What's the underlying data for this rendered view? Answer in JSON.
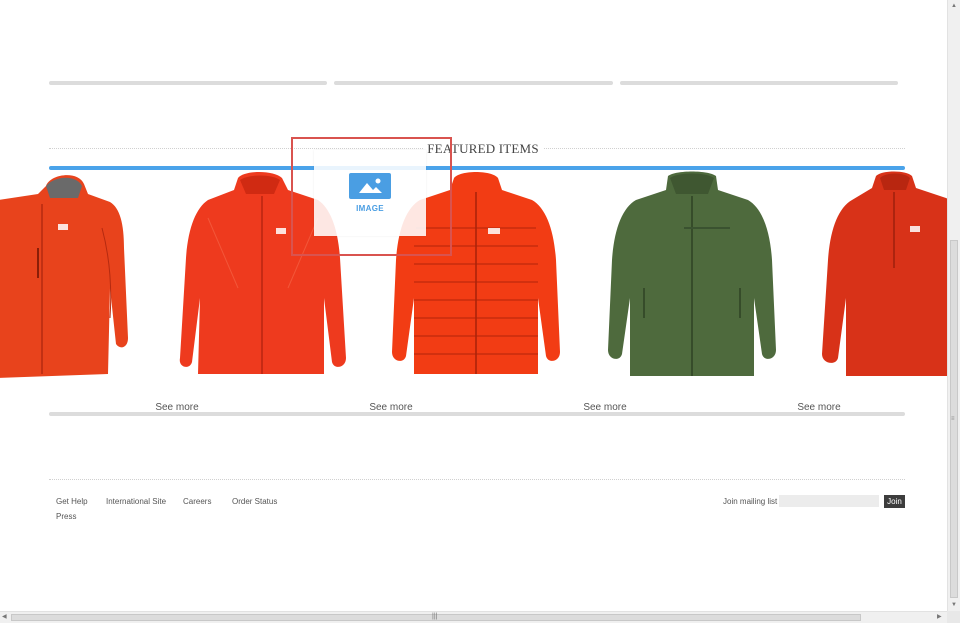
{
  "featured": {
    "title": "FEATURED ITEMS",
    "products": [
      {
        "name": "orange-hooded-jacket",
        "color": "#e8431c",
        "see_more": ""
      },
      {
        "name": "red-windbreaker-jacket",
        "color": "#ee3a1e",
        "see_more": "See more"
      },
      {
        "name": "orange-down-jacket",
        "color": "#f23c14",
        "see_more": "See more"
      },
      {
        "name": "green-softshell-jacket",
        "color": "#4e6a3d",
        "see_more": "See more"
      },
      {
        "name": "red-anorak-jacket",
        "color": "#d83218",
        "see_more": "See more"
      }
    ]
  },
  "image_widget": {
    "label": "IMAGE",
    "icon": "image-icon"
  },
  "footer": {
    "links": [
      "Get Help",
      "International Site",
      "Careers",
      "Order Status",
      "Press"
    ],
    "mailing_label": "Join mailing list",
    "mailing_placeholder": "",
    "join_label": "Join"
  },
  "colors": {
    "accent_blue": "#4aa3ea",
    "selection_red": "#d9534f",
    "button_dark": "#3d3d3d"
  }
}
